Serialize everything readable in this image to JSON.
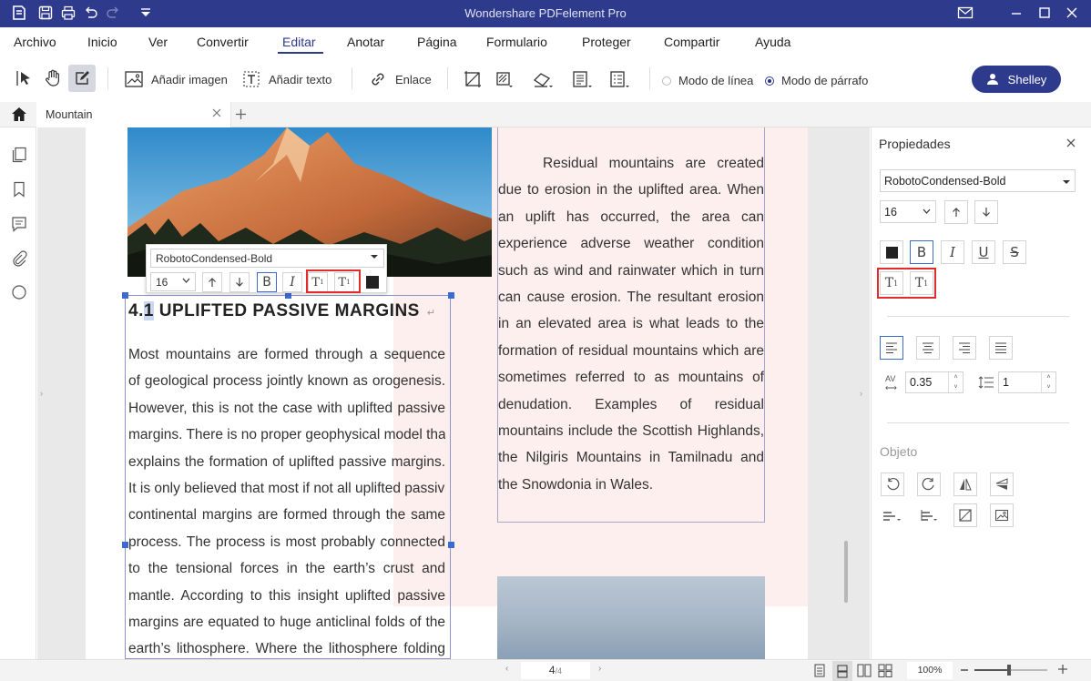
{
  "window": {
    "title": "Wondershare PDFelement Pro"
  },
  "menu": {
    "items": [
      {
        "label": "Archivo"
      },
      {
        "label": "Inicio"
      },
      {
        "label": "Ver"
      },
      {
        "label": "Convertir"
      },
      {
        "label": "Editar"
      },
      {
        "label": "Anotar"
      },
      {
        "label": "Página"
      },
      {
        "label": "Formulario"
      },
      {
        "label": "Proteger"
      },
      {
        "label": "Compartir"
      },
      {
        "label": "Ayuda"
      }
    ],
    "active": "Editar"
  },
  "toolbar": {
    "add_image": "Añadir imagen",
    "add_text": "Añadir texto",
    "link": "Enlace",
    "line_mode": "Modo de línea",
    "paragraph_mode": "Modo de párrafo",
    "user": "Shelley"
  },
  "tabs": [
    {
      "label": "Mountain"
    }
  ],
  "document": {
    "heading_prefix": "4.",
    "heading_hl": "1",
    "heading_rest": " UPLIFTED PASSIVE MARGINS",
    "left_lines": [
      "Most mountains are formed through a sequence",
      "of geological process jointly known as orogenesis.",
      "However, this is not the case with uplifted passive",
      "margins. There is no proper geophysical model that",
      "explains the formation of uplifted passive margins.",
      "It is only believed that most if not all uplifted passive",
      "continental margins are formed through the same",
      "process. The process is most probably connected",
      "to the tensional forces in the earth’s crust and",
      "mantle. According to this insight uplifted passive",
      "margins are equated to huge anticlinal folds of the",
      "earth’s lithosphere. Where the lithosphere folding"
    ],
    "right_paragraph": "Residual mountains are created due to erosion in the uplifted area. When an uplift has occurred, the area can experience adverse weather condition such as wind and rainwater which in turn can cause erosion. The resultant erosion in an elevated area is what leads to the formation of residual mountains which are sometimes referred to as mountains of denudation. Examples of residual mountains include the Scottish Highlands, the Nilgiris Mountains in Tamilnadu and the Snowdonia in Wales."
  },
  "floatbar": {
    "font": "RobotoCondensed-Bold",
    "size": "16"
  },
  "properties": {
    "title": "Propiedades",
    "font": "RobotoCondensed-Bold",
    "size": "16",
    "char_spacing": "0.35",
    "line_spacing": "1",
    "object_label": "Objeto"
  },
  "status": {
    "page_current": "4",
    "page_total": "/4",
    "zoom": "100%"
  },
  "colors": {
    "brand": "#2e3a8c",
    "highlight_box": "#e52a2a",
    "selection": "#3b6bd1"
  }
}
